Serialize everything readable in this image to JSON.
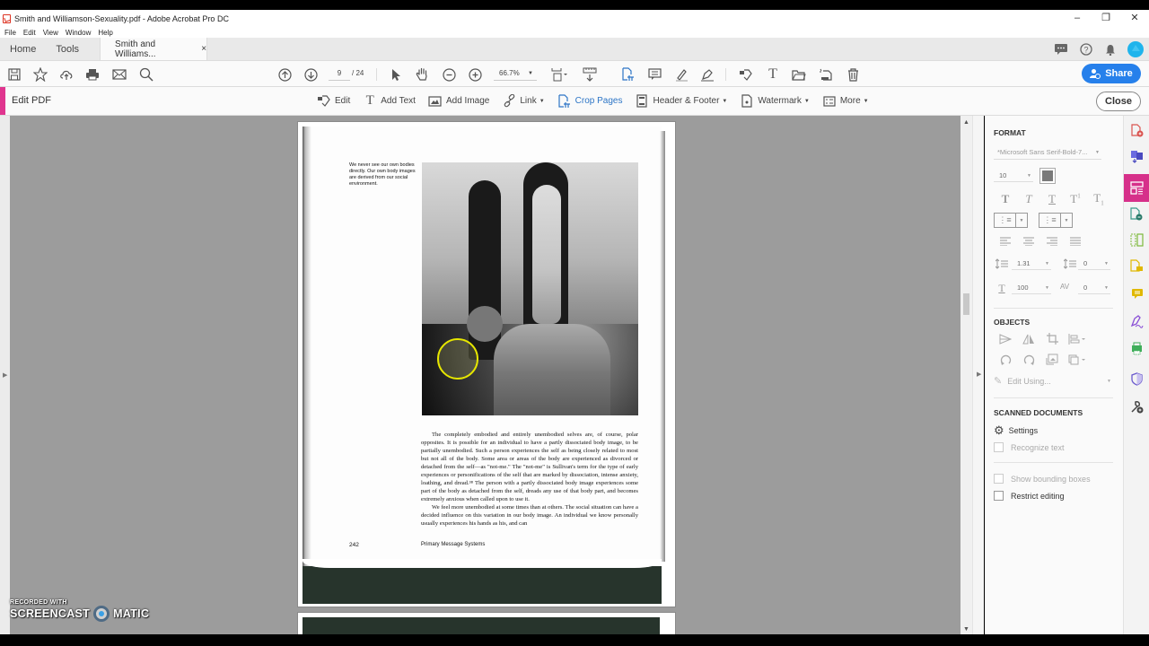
{
  "window": {
    "title": "Smith and Williamson-Sexuality.pdf - Adobe Acrobat Pro DC",
    "controls": [
      "minimize",
      "restore",
      "close"
    ]
  },
  "menu": [
    "File",
    "Edit",
    "View",
    "Window",
    "Help"
  ],
  "tabs": {
    "home": "Home",
    "tools": "Tools",
    "document": "Smith and Williams...",
    "close_glyph": "×"
  },
  "tab_right_icons": [
    "chat-icon",
    "help-icon",
    "bell-icon",
    "account-avatar"
  ],
  "toolbar": {
    "left_icons": [
      "save-icon",
      "bookmark-star-icon",
      "upload-cloud-icon",
      "print-icon",
      "email-icon",
      "search-icon"
    ],
    "page_current": "9",
    "page_total": "/ 24",
    "zoom": "66.7%",
    "share_label": "Share"
  },
  "edit_pdf": {
    "title": "Edit PDF",
    "tools": [
      {
        "label": "Edit",
        "icon": "edit-icon",
        "dropdown": false
      },
      {
        "label": "Add Text",
        "icon": "add-text-icon",
        "dropdown": false
      },
      {
        "label": "Add Image",
        "icon": "add-image-icon",
        "dropdown": false
      },
      {
        "label": "Link",
        "icon": "link-icon",
        "dropdown": true
      },
      {
        "label": "Crop Pages",
        "icon": "crop-pages-icon",
        "dropdown": false,
        "active": true
      },
      {
        "label": "Header & Footer",
        "icon": "header-footer-icon",
        "dropdown": true
      },
      {
        "label": "Watermark",
        "icon": "watermark-icon",
        "dropdown": true
      },
      {
        "label": "More",
        "icon": "more-icon",
        "dropdown": true
      }
    ],
    "close_label": "Close",
    "accent_color": "#e0358f"
  },
  "document": {
    "caption": "We never see our own bodies directly. Our own body images are derived from our social environment.",
    "paragraphs": [
      "The completely embodied and entirely unembodied selves are, of course, polar opposites. It is possible for an individual to have a partly dissociated body image, to be partially unembodied. Such a person experiences the self as being closely related to most but not all of the body. Some area or areas of the body are experienced as divorced or detached from the self—as \"not-me.\" The \"not-me\" is Sullivan's term for the type of early experiences or personifications of the self that are marked by dissociation, intense anxiety, loathing, and dread.³⁸ The person with a partly dissociated body image experiences some part of the body as detached from the self, dreads any use of that body part, and becomes extremely anxious when called upon to use it.",
      "We feel more unembodied at some times than at others. The social situation can have a decided influence on this variation in our body image. An individual we know personally usually experiences his hands as his, and can"
    ],
    "page_number": "242",
    "running_footer": "Primary Message Systems"
  },
  "format_panel": {
    "format_heading": "FORMAT",
    "font_name": "*Microsoft Sans Serif-Bold-7...",
    "font_size": "10",
    "text_color": "#7a7a7a",
    "text_style_icons": [
      "bold-T-icon",
      "italic-T-icon",
      "underline-T-icon",
      "superscript-T-icon",
      "subscript-T-icon"
    ],
    "align_icons": [
      "align-left-icon",
      "align-center-icon",
      "align-right-icon",
      "justify-icon"
    ],
    "line_spacing": "1.31",
    "paragraph_spacing": "0",
    "horizontal_scale": "100",
    "char_spacing": "0",
    "objects_heading": "OBJECTS",
    "edit_using": "Edit Using...",
    "scanned_heading": "SCANNED DOCUMENTS",
    "settings_label": "Settings",
    "recognize_text": "Recognize text",
    "show_bounding_boxes": "Show bounding boxes",
    "restrict_editing": "Restrict editing"
  },
  "tool_rail": [
    {
      "name": "create-pdf-icon",
      "color": "#d9534f"
    },
    {
      "name": "export-pdf-icon",
      "color": "#5b5bd6"
    },
    {
      "name": "edit-pdf-icon",
      "color": "#ffffff",
      "active": true
    },
    {
      "name": "combine-files-icon",
      "color": "#3a9a8a"
    },
    {
      "name": "organize-pages-icon",
      "color": "#7cba3a"
    },
    {
      "name": "comment-file-icon",
      "color": "#e0b800"
    },
    {
      "name": "comment-icon",
      "color": "#e0b800"
    },
    {
      "name": "fill-sign-icon",
      "color": "#8a4fd6"
    },
    {
      "name": "scan-icon",
      "color": "#3fae5a"
    },
    {
      "name": "protect-icon",
      "color": "#6a5acd"
    },
    {
      "name": "more-tools-icon",
      "color": "#444444"
    }
  ],
  "watermark": {
    "line1": "RECORDED WITH",
    "line2a": "SCREENCAST",
    "line2b": "MATIC"
  }
}
